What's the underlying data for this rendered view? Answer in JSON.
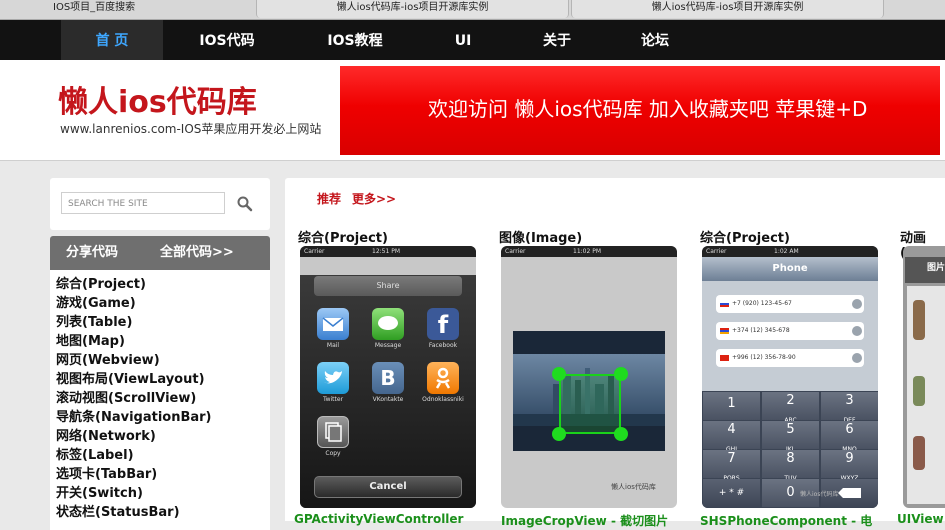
{
  "browser": {
    "tabs": [
      "IOS项目_百度搜索",
      "懒人ios代码库-ios项目开源库实例",
      "懒人ios代码库-ios项目开源库实例"
    ]
  },
  "nav": {
    "items": [
      "首 页",
      "IOS代码",
      "IOS教程",
      "UI",
      "关于",
      "论坛"
    ],
    "active_color": "#3ea7ff"
  },
  "header": {
    "logo": "懒人ios代码库",
    "slogan": "www.lanrenios.com-IOS苹果应用开发必上网站",
    "banner": "欢迎访问 懒人ios代码库 加入收藏夹吧 苹果键+D",
    "brand_color": "#c4161c"
  },
  "sidebar": {
    "search_placeholder": "SEARCH THE SITE",
    "head_left": "分享代码",
    "head_right": "全部代码>>",
    "items": [
      "综合(Project)",
      "游戏(Game)",
      "列表(Table)",
      "地图(Map)",
      "网页(Webview)",
      "视图布局(ViewLayout)",
      "滚动视图(ScrollView)",
      "导航条(NavigationBar)",
      "网络(Network)",
      "标签(Label)",
      "选项卡(TabBar)",
      "开关(Switch)",
      "状态栏(StatusBar)"
    ]
  },
  "main": {
    "rec_label": "推荐",
    "more_label": "更多>>",
    "cards": [
      {
        "category": "综合(Project)",
        "caption": "GPActivityViewController"
      },
      {
        "category": "图像(Image)",
        "caption": "ImageCropView - 截切图片"
      },
      {
        "category": "综合(Project)",
        "caption": "SHSPhoneComponent - 电"
      },
      {
        "category": "动画 (A",
        "caption": "UIView"
      }
    ],
    "share_sheet": {
      "carrier": "Carrier",
      "time1": "12:51 PM",
      "time2": "11:02 PM",
      "time3": "1:02 AM",
      "title": "Share",
      "apps": [
        "Mail",
        "Message",
        "Facebook",
        "Twitter",
        "VKontakte",
        "Odnoklassniki",
        "Copy"
      ],
      "cancel": "Cancel"
    },
    "phone": {
      "title": "Phone",
      "numbers": [
        "+7 (920) 123-45-67",
        "+374 (12) 345-678",
        "+996 (12) 356-78-90"
      ],
      "keys": [
        "1",
        "2",
        "3",
        "4",
        "5",
        "6",
        "7",
        "8",
        "9",
        "+ * #",
        "0"
      ],
      "key_letters": [
        "",
        "ABC",
        "DEF",
        "GHI",
        "JKL",
        "MNO",
        "PQRS",
        "TUV",
        "WXYZ"
      ]
    },
    "watermark": "懒人ios代码库",
    "fourth_badge": "图片"
  }
}
